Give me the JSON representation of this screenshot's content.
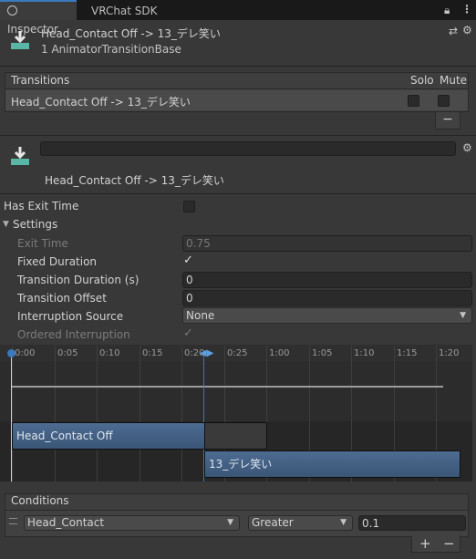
{
  "tabs": [
    {
      "label": "Inspector"
    },
    {
      "label": "VRChat SDK"
    }
  ],
  "header": {
    "title": "Head_Contact Off -> 13_デレ笑い",
    "subtitle": "1 AnimatorTransitionBase"
  },
  "transitions": {
    "title": "Transitions",
    "solo_label": "Solo",
    "mute_label": "Mute",
    "rows": [
      {
        "name": "Head_Contact Off -> 13_デレ笑い",
        "solo": false,
        "mute": false
      }
    ],
    "remove_label": "−"
  },
  "transition_detail": {
    "name_value": "",
    "caption": "Head_Contact Off -> 13_デレ笑い"
  },
  "settings": {
    "has_exit_time_label": "Has Exit Time",
    "has_exit_time": false,
    "section_label": "Settings",
    "exit_time_label": "Exit Time",
    "exit_time_value": "0.75",
    "fixed_duration_label": "Fixed Duration",
    "fixed_duration": true,
    "transition_duration_label": "Transition Duration (s)",
    "transition_duration_value": "0",
    "transition_offset_label": "Transition Offset",
    "transition_offset_value": "0",
    "interruption_source_label": "Interruption Source",
    "interruption_source_value": "None",
    "ordered_interruption_label": "Ordered Interruption",
    "ordered_interruption": true
  },
  "timeline": {
    "ticks": [
      "0:00",
      "0:05",
      "0:10",
      "0:15",
      "0:20",
      "0:25",
      "1:00",
      "1:05",
      "1:10",
      "1:15",
      "1:20"
    ],
    "source_state": "Head_Contact Off",
    "dest_state": "13_デレ笑い"
  },
  "conditions": {
    "title": "Conditions",
    "parameter": "Head_Contact",
    "mode": "Greater",
    "threshold": "0.1",
    "add_label": "+",
    "remove_label": "−"
  },
  "colors": {
    "accent": "#3a79bb",
    "state_bar": "#42607f",
    "background": "#383838"
  }
}
